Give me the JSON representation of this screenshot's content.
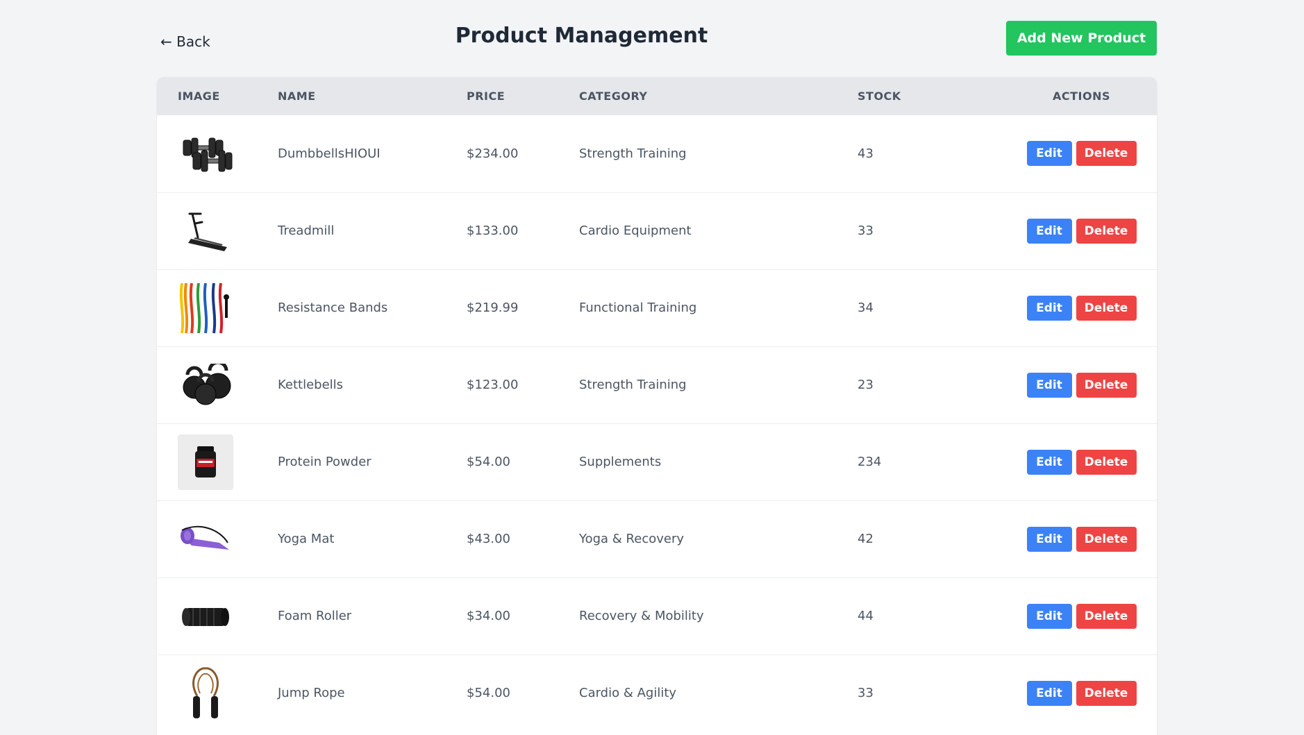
{
  "header": {
    "back_label": "← Back",
    "title": "Product Management",
    "add_button_label": "Add New Product"
  },
  "table": {
    "columns": [
      "IMAGE",
      "NAME",
      "PRICE",
      "CATEGORY",
      "STOCK",
      "ACTIONS"
    ],
    "edit_label": "Edit",
    "delete_label": "Delete",
    "rows": [
      {
        "image": "dumbbells-image",
        "name": "DumbbellsHIOUI",
        "price": "$234.00",
        "category": "Strength Training",
        "stock": "43"
      },
      {
        "image": "treadmill-image",
        "name": "Treadmill",
        "price": "$133.00",
        "category": "Cardio Equipment",
        "stock": "33"
      },
      {
        "image": "resistance-bands-image",
        "name": "Resistance Bands",
        "price": "$219.99",
        "category": "Functional Training",
        "stock": "34"
      },
      {
        "image": "kettlebells-image",
        "name": "Kettlebells",
        "price": "$123.00",
        "category": "Strength Training",
        "stock": "23"
      },
      {
        "image": "protein-powder-image",
        "name": "Protein Powder",
        "price": "$54.00",
        "category": "Supplements",
        "stock": "234"
      },
      {
        "image": "yoga-mat-image",
        "name": "Yoga Mat",
        "price": "$43.00",
        "category": "Yoga & Recovery",
        "stock": "42"
      },
      {
        "image": "foam-roller-image",
        "name": "Foam Roller",
        "price": "$34.00",
        "category": "Recovery & Mobility",
        "stock": "44"
      },
      {
        "image": "jump-rope-image",
        "name": "Jump Rope",
        "price": "$54.00",
        "category": "Cardio & Agility",
        "stock": "33"
      }
    ]
  },
  "colors": {
    "background": "#f3f4f6",
    "add_button": "#22c55e",
    "edit_button": "#3b82f6",
    "delete_button": "#ef4444",
    "header_row": "#e5e7eb"
  }
}
